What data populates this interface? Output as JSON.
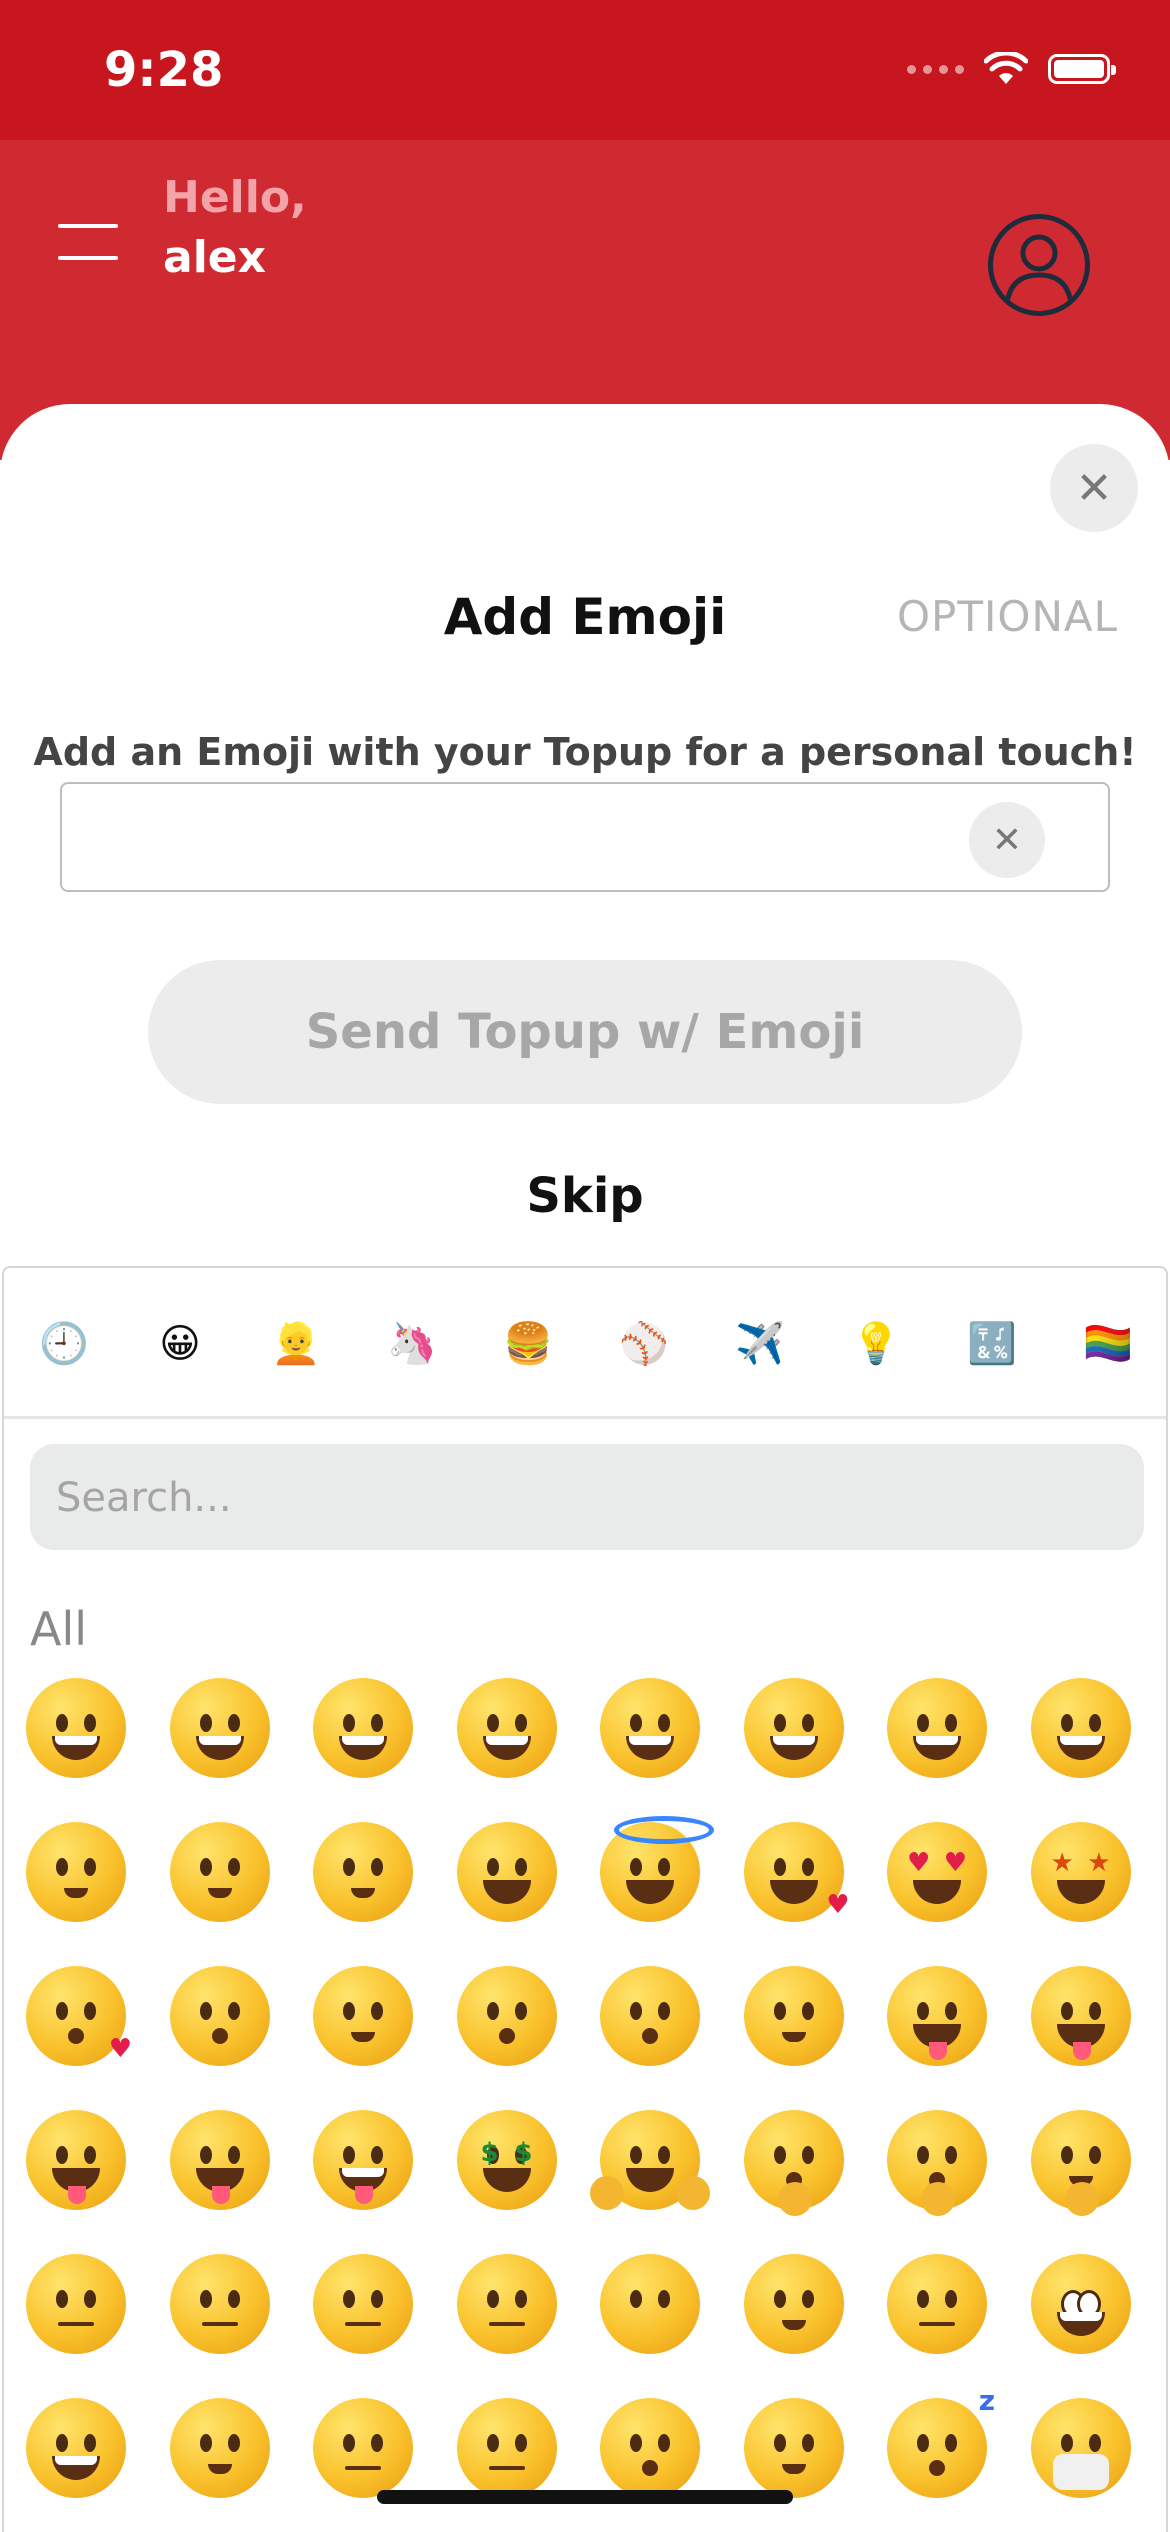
{
  "status_bar": {
    "time": "9:28"
  },
  "header": {
    "greeting": "Hello,",
    "username": "alex"
  },
  "sheet": {
    "title": "Add Emoji",
    "optional_label": "OPTIONAL",
    "subtitle": "Add an Emoji with your Topup for a personal touch!",
    "input_value": "",
    "send_button_label": "Send Topup w/ Emoji",
    "skip_label": "Skip"
  },
  "picker": {
    "categories": [
      {
        "name": "recent",
        "glyph": "🕘"
      },
      {
        "name": "smileys",
        "glyph": "😀"
      },
      {
        "name": "people",
        "glyph": "👱"
      },
      {
        "name": "animals",
        "glyph": "🦄"
      },
      {
        "name": "food",
        "glyph": "🍔"
      },
      {
        "name": "activities",
        "glyph": "⚾"
      },
      {
        "name": "travel",
        "glyph": "✈️"
      },
      {
        "name": "objects",
        "glyph": "💡"
      },
      {
        "name": "symbols",
        "glyph": "🔣"
      },
      {
        "name": "flags",
        "glyph": "🏳️‍🌈"
      }
    ],
    "search_placeholder": "Search...",
    "section_label": "All",
    "emojis": [
      "grinning-face",
      "grinning-face-big-eyes",
      "grinning-face-smiling-eyes",
      "beaming-face",
      "squinting-face",
      "grinning-face-sweat",
      "rolling-on-floor-laughing",
      "face-tears-of-joy",
      "slightly-smiling-face",
      "upside-down-face",
      "winking-face",
      "smiling-face-smiling-eyes",
      "smiling-face-halo",
      "smiling-face-hearts",
      "heart-eyes",
      "star-struck",
      "face-blowing-kiss",
      "kissing-face",
      "smiling-face",
      "kissing-face-closed-eyes",
      "kissing-face-smiling-eyes",
      "smiling-face-tear",
      "face-savoring-food",
      "face-with-tongue",
      "winking-face-tongue",
      "zany-face",
      "squinting-face-tongue",
      "money-mouth-face",
      "hugging-face",
      "face-hand-over-mouth",
      "shushing-face",
      "thinking-face",
      "zipper-mouth-face",
      "raised-eyebrow-face",
      "neutral-face",
      "expressionless-face",
      "face-without-mouth",
      "smirking-face",
      "unamused-face",
      "rolling-eyes",
      "grimacing-face",
      "lying-face",
      "relieved-face",
      "pensive-face",
      "sleepy-face",
      "drooling-face",
      "sleeping-face",
      "face-medical-mask"
    ]
  }
}
